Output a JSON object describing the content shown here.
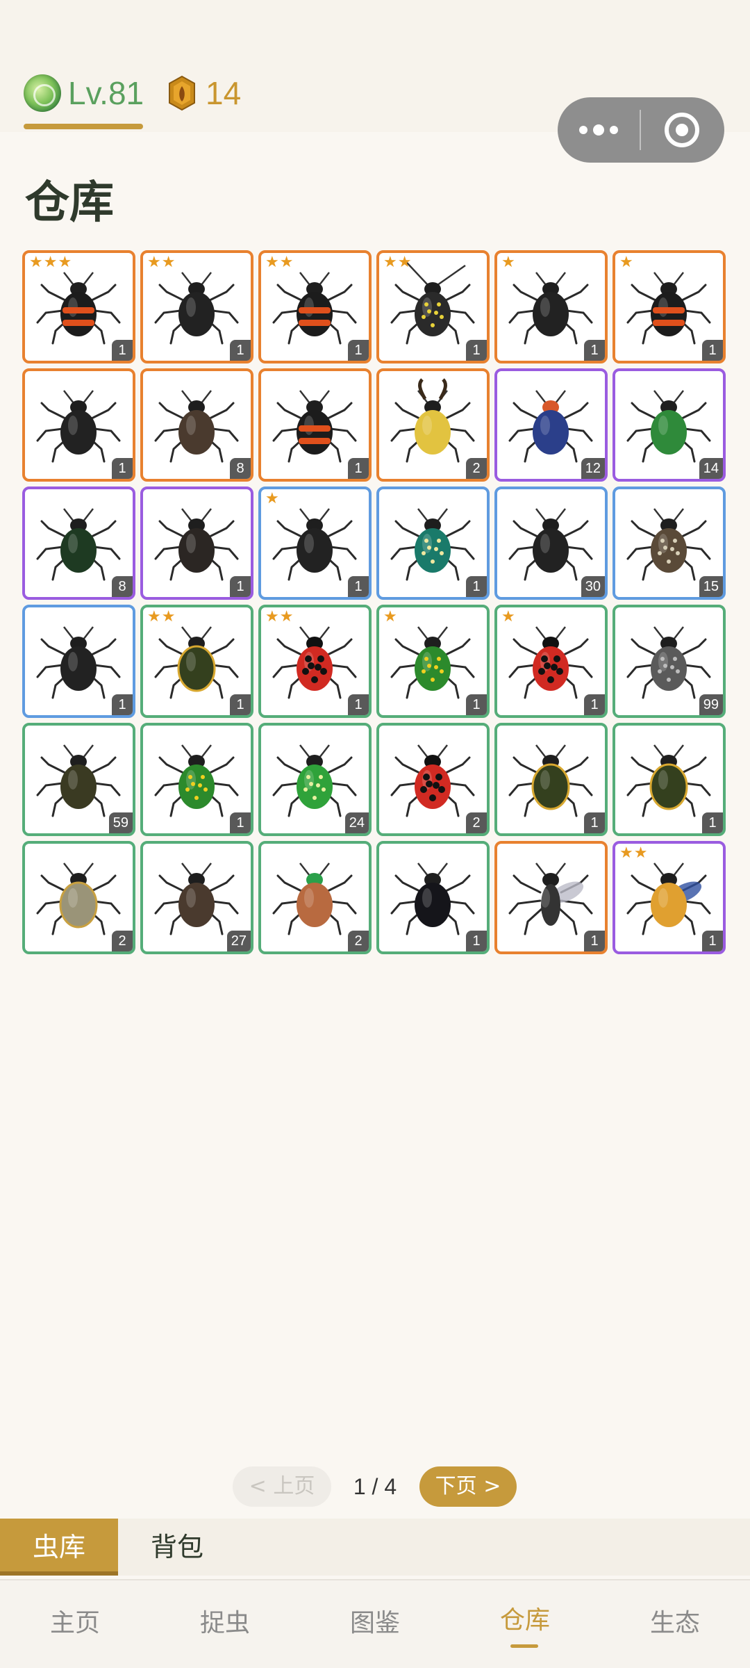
{
  "header": {
    "level_label": "Lv.81",
    "coin_count": "14",
    "level_icon": "green-orb-icon",
    "coin_icon": "amber-coin-icon"
  },
  "capsule": {
    "more_icon": "more-dots-icon",
    "close_icon": "target-icon"
  },
  "page": {
    "title": "仓库"
  },
  "colors": {
    "accent": "#c69a3c",
    "rarity_orange": "#e8812f",
    "rarity_purple": "#9a5ce0",
    "rarity_blue": "#5f9be0",
    "rarity_green": "#55ad79"
  },
  "insects": [
    {
      "rarity": "orange",
      "stars": "★★★",
      "count": "1",
      "icon": "burying-beetle-icon"
    },
    {
      "rarity": "orange",
      "stars": "★★",
      "count": "1",
      "icon": "ground-beetle-icon"
    },
    {
      "rarity": "orange",
      "stars": "★★",
      "count": "1",
      "icon": "burying-beetle-icon"
    },
    {
      "rarity": "orange",
      "stars": "★★",
      "count": "1",
      "icon": "longhorn-beetle-icon"
    },
    {
      "rarity": "orange",
      "stars": "★",
      "count": "1",
      "icon": "ground-beetle-icon"
    },
    {
      "rarity": "orange",
      "stars": "★",
      "count": "1",
      "icon": "burying-beetle-icon"
    },
    {
      "rarity": "orange",
      "stars": "",
      "count": "1",
      "icon": "ground-beetle-icon"
    },
    {
      "rarity": "orange",
      "stars": "",
      "count": "8",
      "icon": "chafer-beetle-icon"
    },
    {
      "rarity": "orange",
      "stars": "",
      "count": "1",
      "icon": "burying-beetle-icon"
    },
    {
      "rarity": "orange",
      "stars": "",
      "count": "2",
      "icon": "stag-beetle-icon"
    },
    {
      "rarity": "purple",
      "stars": "",
      "count": "12",
      "icon": "blue-beetle-icon"
    },
    {
      "rarity": "purple",
      "stars": "",
      "count": "14",
      "icon": "green-ground-beetle-icon"
    },
    {
      "rarity": "purple",
      "stars": "",
      "count": "8",
      "icon": "green-beetle-icon"
    },
    {
      "rarity": "purple",
      "stars": "",
      "count": "1",
      "icon": "dung-beetle-icon"
    },
    {
      "rarity": "blue",
      "stars": "★",
      "count": "1",
      "icon": "ground-beetle-icon"
    },
    {
      "rarity": "blue",
      "stars": "",
      "count": "1",
      "icon": "tiger-beetle-icon"
    },
    {
      "rarity": "blue",
      "stars": "",
      "count": "30",
      "icon": "ground-beetle-icon"
    },
    {
      "rarity": "blue",
      "stars": "",
      "count": "15",
      "icon": "spotted-chafer-icon"
    },
    {
      "rarity": "blue",
      "stars": "",
      "count": "1",
      "icon": "ground-beetle-icon"
    },
    {
      "rarity": "green",
      "stars": "★★",
      "count": "1",
      "icon": "diving-beetle-icon"
    },
    {
      "rarity": "green",
      "stars": "★★",
      "count": "1",
      "icon": "ladybug-icon"
    },
    {
      "rarity": "green",
      "stars": "★",
      "count": "1",
      "icon": "spotted-green-beetle-icon"
    },
    {
      "rarity": "green",
      "stars": "★",
      "count": "1",
      "icon": "ladybug-icon"
    },
    {
      "rarity": "green",
      "stars": "",
      "count": "99",
      "icon": "gray-beetle-icon"
    },
    {
      "rarity": "green",
      "stars": "",
      "count": "59",
      "icon": "scarab-beetle-icon"
    },
    {
      "rarity": "green",
      "stars": "",
      "count": "1",
      "icon": "spotted-green-beetle-icon"
    },
    {
      "rarity": "green",
      "stars": "",
      "count": "24",
      "icon": "jewel-chafer-icon"
    },
    {
      "rarity": "green",
      "stars": "",
      "count": "2",
      "icon": "ladybug-icon"
    },
    {
      "rarity": "green",
      "stars": "",
      "count": "1",
      "icon": "diving-beetle-icon"
    },
    {
      "rarity": "green",
      "stars": "",
      "count": "1",
      "icon": "diving-beetle-icon"
    },
    {
      "rarity": "green",
      "stars": "",
      "count": "2",
      "icon": "striped-beetle-icon"
    },
    {
      "rarity": "green",
      "stars": "",
      "count": "27",
      "icon": "chafer-beetle-icon"
    },
    {
      "rarity": "green",
      "stars": "",
      "count": "2",
      "icon": "green-head-beetle-icon"
    },
    {
      "rarity": "green",
      "stars": "",
      "count": "1",
      "icon": "black-water-beetle-icon"
    },
    {
      "rarity": "orange",
      "stars": "",
      "count": "1",
      "icon": "wasp-icon"
    },
    {
      "rarity": "purple",
      "stars": "★★",
      "count": "1",
      "icon": "bee-icon"
    }
  ],
  "pager": {
    "prev_label": "< 上页",
    "indicator": "1 / 4",
    "next_label": "下页 >"
  },
  "sub_tabs": {
    "active_label": "虫库",
    "other_label": "背包"
  },
  "bottom_nav": [
    "主页",
    "捉虫",
    "图鉴",
    "仓库",
    "生态"
  ]
}
